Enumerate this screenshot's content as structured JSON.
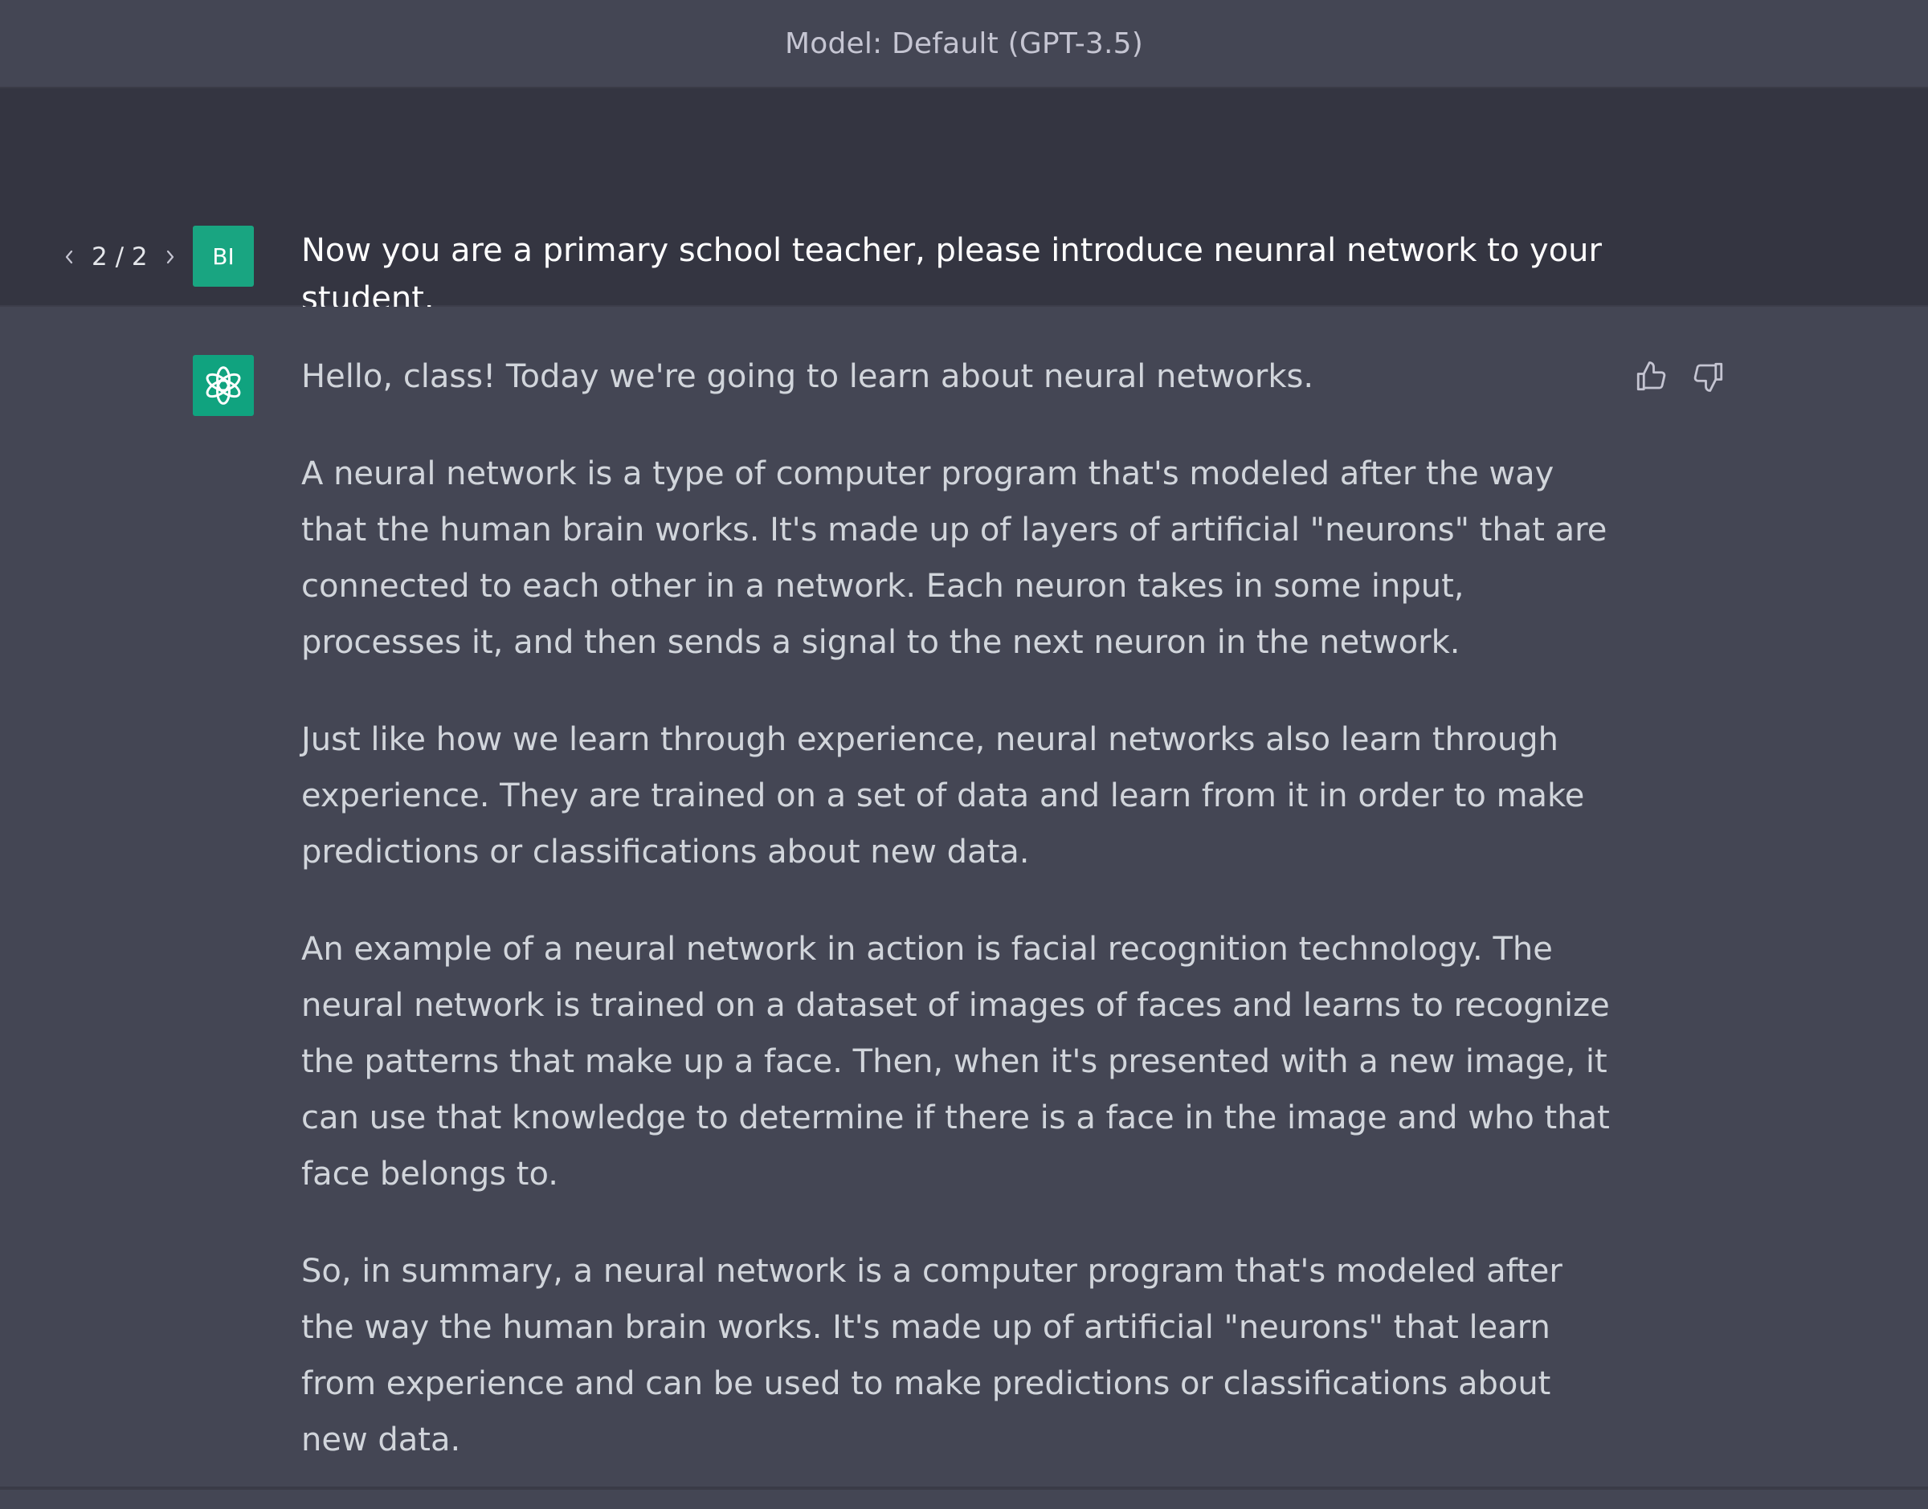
{
  "header": {
    "model_label": "Model: Default (GPT-3.5)"
  },
  "user_message": {
    "pager": "2 / 2",
    "avatar_initials": "BI",
    "text": "Now you are a primary school teacher, please introduce neunral network to your student."
  },
  "assistant_message": {
    "avatar_icon": "openai-logo-icon",
    "paragraphs": [
      "Hello, class! Today we're going to learn about neural networks.",
      "A neural network is a type of computer program that's modeled after the way that the human brain works. It's made up of layers of artificial \"neurons\" that are connected to each other in a network. Each neuron takes in some input, processes it, and then sends a signal to the next neuron in the network.",
      "Just like how we learn through experience, neural networks also learn through experience. They are trained on a set of data and learn from it in order to make predictions or classifications about new data.",
      "An example of a neural network in action is facial recognition technology. The neural network is trained on a dataset of images of faces and learns to recognize the patterns that make up a face. Then, when it's presented with a new image, it can use that knowledge to determine if there is a face in the image and who that face belongs to.",
      "So, in summary, a neural network is a computer program that's modeled after the way the human brain works. It's made up of artificial \"neurons\" that learn from experience and can be used to make predictions or classifications about new data."
    ],
    "feedback_icons": [
      "thumbs-up-icon",
      "thumbs-down-icon"
    ]
  },
  "colors": {
    "page_bg": "#444654",
    "user_row_bg": "#343541",
    "user_avatar_bg": "#19a581",
    "bot_avatar_bg": "#10a37f",
    "assistant_text": "#d1d5db"
  }
}
